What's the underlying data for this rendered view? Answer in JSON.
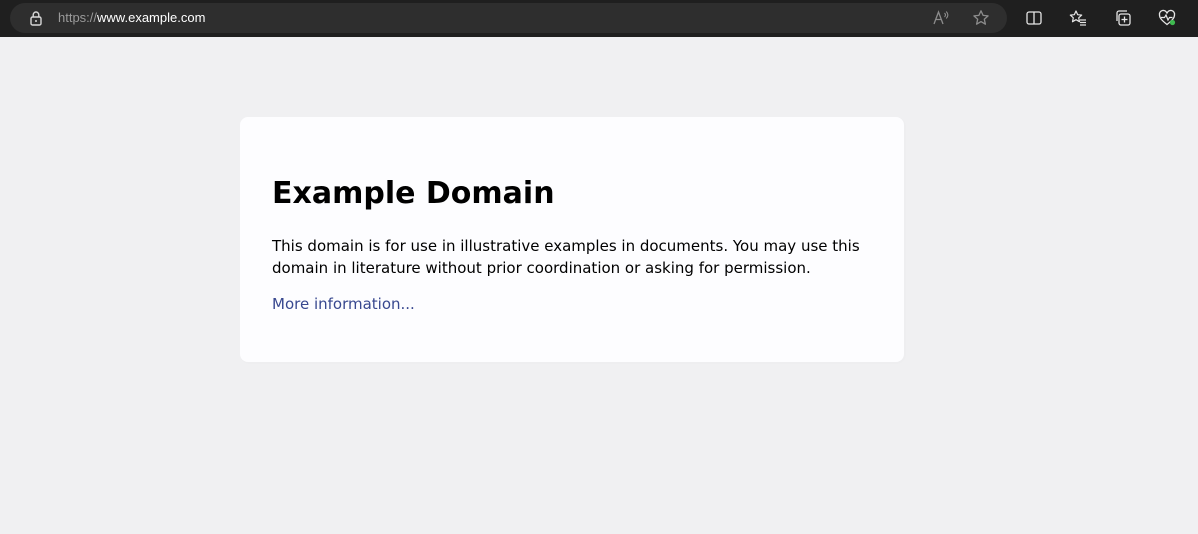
{
  "browser": {
    "url_scheme": "https://",
    "url_host": "www.example.com",
    "icons": {
      "lock": "lock-icon",
      "read_aloud": "read-aloud-icon",
      "favorite": "star-icon",
      "split_screen": "split-screen-icon",
      "favorites": "favorites-icon",
      "collections": "collections-icon",
      "browser_essentials": "heart-pulse-icon"
    },
    "colors": {
      "toolbar_bg": "#1f1f1f",
      "address_bg": "#2e2e2e",
      "status_dot": "#3fb950"
    }
  },
  "page": {
    "title": "Example Domain",
    "description": "This domain is for use in illustrative examples in documents. You may use this domain in literature without prior coordination or asking for permission.",
    "link_text": "More information...",
    "colors": {
      "background": "#f0f0f2",
      "card": "#fdfdff",
      "link": "#38488f"
    }
  }
}
